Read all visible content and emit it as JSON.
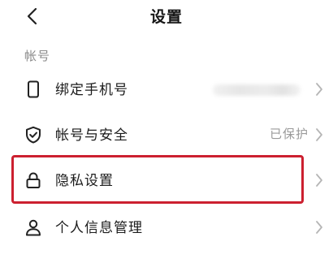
{
  "header": {
    "title": "设置",
    "back_icon": "chevron-left-icon"
  },
  "section": {
    "title": "帐号"
  },
  "rows": [
    {
      "label": "绑定手机号",
      "icon": "phone-icon",
      "value": "",
      "value_blurred": true,
      "chevron": "chevron-right-icon"
    },
    {
      "label": "帐号与安全",
      "icon": "shield-check-icon",
      "value": "已保护",
      "chevron": "chevron-right-icon"
    },
    {
      "label": "隐私设置",
      "icon": "lock-icon",
      "value": "",
      "chevron": "chevron-right-icon",
      "highlighted": true
    },
    {
      "label": "个人信息管理",
      "icon": "user-icon",
      "value": "",
      "chevron": "chevron-right-icon"
    }
  ],
  "colors": {
    "highlight_border": "#cc2030",
    "secondary_text": "#9a9a9a",
    "chevron": "#b5b5b5"
  }
}
